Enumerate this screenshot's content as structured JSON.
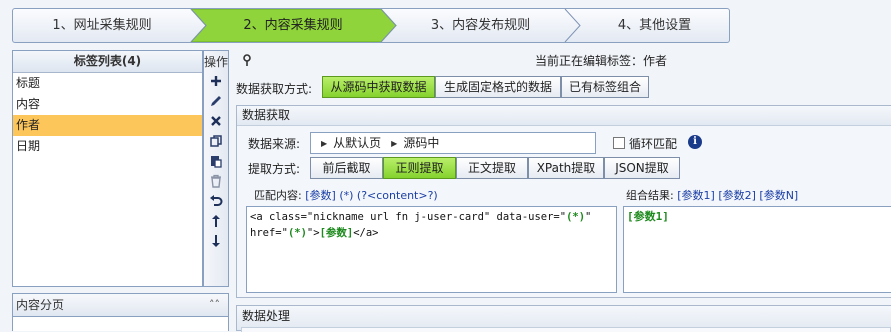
{
  "wizard": {
    "steps": [
      {
        "label": "1、网址采集规则",
        "active": false
      },
      {
        "label": "2、内容采集规则",
        "active": true
      },
      {
        "label": "3、内容发布规则",
        "active": false
      },
      {
        "label": "4、其他设置",
        "active": false
      }
    ],
    "active_color": "#8fd43a"
  },
  "taglist": {
    "header": "标签列表(4)",
    "items": [
      {
        "label": "标题"
      },
      {
        "label": "内容"
      },
      {
        "label": "作者",
        "selected": true
      },
      {
        "label": "日期"
      }
    ],
    "selected_color": "#fcc65b"
  },
  "ops": {
    "title": "操作",
    "icons": [
      "plus-icon",
      "edit-icon",
      "delete-icon",
      "copy-icon",
      "paste-icon",
      "trash-icon",
      "undo-icon",
      "move-up-icon",
      "move-down-icon"
    ]
  },
  "paging": {
    "label": "内容分页"
  },
  "editor": {
    "editing_text": "当前正在编辑标签：作者",
    "method_label": "数据获取方式:",
    "methods": [
      {
        "label": "从源码中获取数据",
        "active": true
      },
      {
        "label": "生成固定格式的数据",
        "active": false
      },
      {
        "label": "已有标签组合",
        "active": false
      }
    ],
    "group_title": "数据获取",
    "source_label": "数据来源:",
    "source_crumbs": [
      "从默认页",
      "源码中"
    ],
    "loop_label": "循环匹配",
    "loop_checked": false,
    "extract_label": "提取方式:",
    "extract_methods": [
      {
        "label": "前后截取",
        "active": false
      },
      {
        "label": "正则提取",
        "active": true
      },
      {
        "label": "正文提取",
        "active": false
      },
      {
        "label": "XPath提取",
        "active": false
      },
      {
        "label": "JSON提取",
        "active": false
      }
    ],
    "match_label": "匹配内容:",
    "match_tokens": [
      "[参数]",
      "(*)",
      "(?<content>?)"
    ],
    "result_label": "组合结果:",
    "result_tokens": [
      "[参数1]",
      "[参数2]",
      "[参数N]"
    ],
    "code_parts": {
      "p1": "<a class=\"nickname url fn j-user-card\" data-user=\"",
      "p2": "(*)",
      "p3": "\"\nhref=\"",
      "p4": "(*)",
      "p5": "\">",
      "p6": "[参数]",
      "p7": "</a>"
    },
    "result_value": "[参数1]",
    "process_title": "数据处理"
  }
}
